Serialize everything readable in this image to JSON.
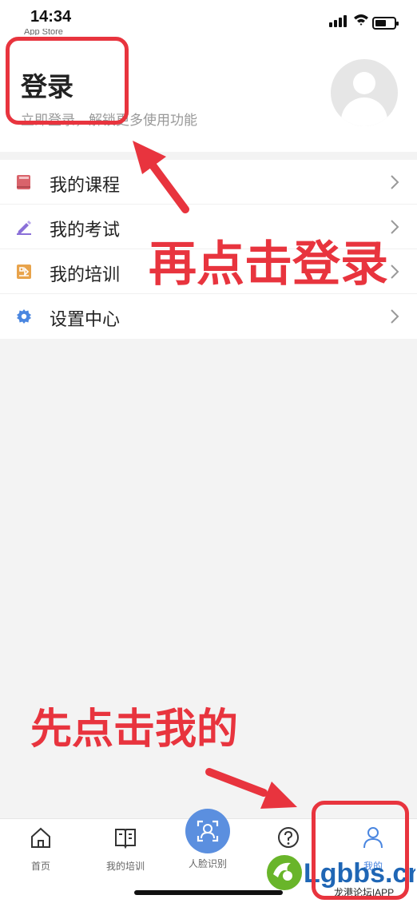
{
  "status_bar": {
    "time": "14:34",
    "back_app": "App Store",
    "icons": [
      "cellular-signal-icon",
      "wifi-icon",
      "battery-icon"
    ],
    "battery_level": 0.6
  },
  "header": {
    "title": "登录",
    "subtitle": "立即登录，解锁更多使用功能",
    "avatar_icon": "default-avatar-icon"
  },
  "menu": {
    "items": [
      {
        "label": "我的课程",
        "icon": "book-icon",
        "color": "#d9636b"
      },
      {
        "label": "我的考试",
        "icon": "pencil-icon",
        "color": "#8a6fd8"
      },
      {
        "label": "我的培训",
        "icon": "training-icon",
        "color": "#e8a34b"
      },
      {
        "label": "设置中心",
        "icon": "gear-icon",
        "color": "#4a86e0"
      }
    ]
  },
  "annotations": {
    "step2": "再点击登录",
    "step1": "先点击我的",
    "color": "#e8343e"
  },
  "tabbar": {
    "tabs": [
      {
        "label": "首页",
        "icon": "home-icon"
      },
      {
        "label": "我的培训",
        "icon": "book-open-icon"
      },
      {
        "label": "人脸识别",
        "icon": "face-scan-icon"
      },
      {
        "label": "帮助",
        "icon": "help-icon"
      },
      {
        "label": "我的",
        "icon": "user-icon"
      }
    ],
    "accent": "#5b8fdf"
  },
  "watermark": {
    "logo_text": "Lgbbs.cn",
    "sub_text": "龙港论坛|APP"
  }
}
